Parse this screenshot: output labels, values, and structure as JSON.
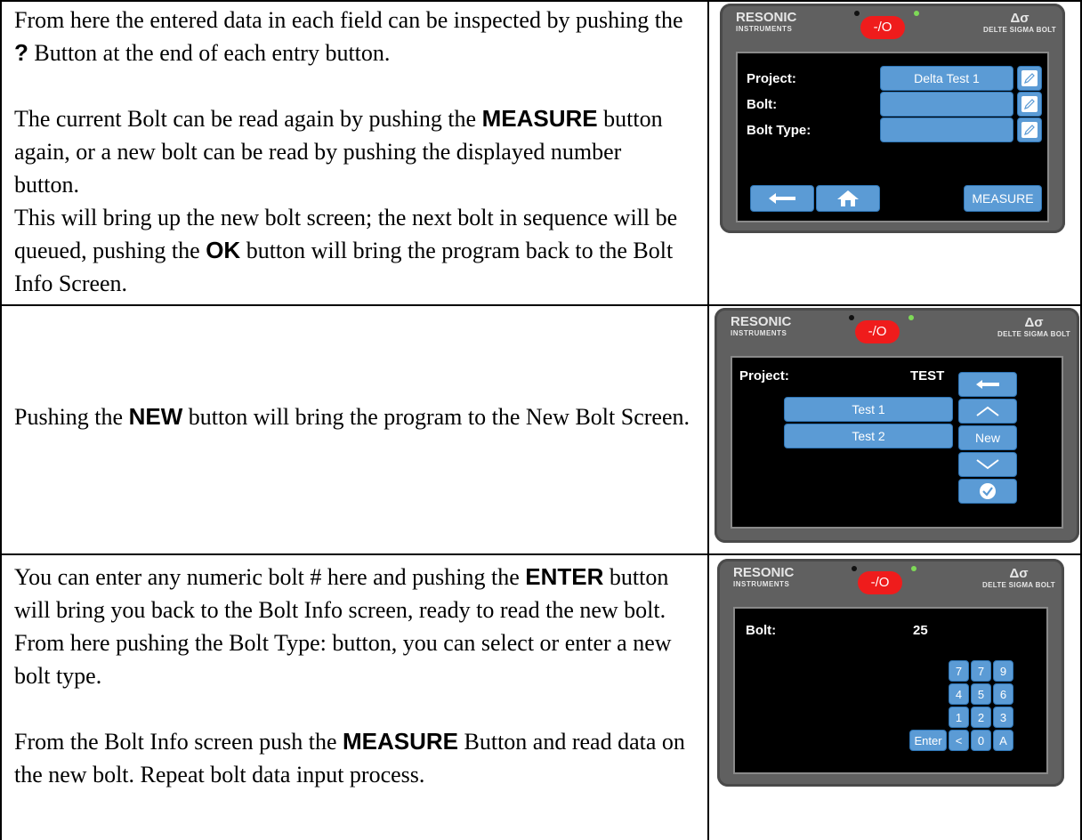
{
  "rows": [
    {
      "paragraphs": [
        [
          "From here the entered data in each field can be inspected by pushing the ",
          {
            "kw": "?"
          },
          " Button at the end of each entry button."
        ],
        [],
        [
          "The current Bolt can be read again by pushing the ",
          {
            "kw": "MEASURE"
          },
          " button again, or a new bolt can be read by pushing the displayed number button."
        ],
        [
          "This will bring up the new bolt screen; the next bolt in sequence will be queued, pushing the ",
          {
            "kw": "OK"
          },
          " button will bring the program back to the Bolt Info Screen."
        ]
      ]
    },
    {
      "paragraphs": [
        [
          "Pushing the ",
          {
            "kw": "NEW"
          },
          " button will bring the program to the New Bolt Screen."
        ]
      ]
    },
    {
      "paragraphs": [
        [
          "You can enter any numeric bolt # here and pushing the ",
          {
            "kw": "ENTER"
          },
          " button will bring you back to the Bolt Info screen, ready to read the new bolt. From here pushing the Bolt Type: button, you can select or enter a new bolt type."
        ],
        [],
        [
          "From the Bolt Info screen push the ",
          {
            "kw": "MEASURE"
          },
          " Button and read data on the new bolt. Repeat bolt data input process."
        ]
      ]
    }
  ],
  "device": {
    "brand": "RESONIC",
    "brand_sub": "INSTRUMENTS",
    "logo_symbol": "Δσ",
    "logo_sub": "DELTE SIGMA BOLT",
    "power_label": "-/O"
  },
  "screen1": {
    "project_label": "Project:",
    "bolt_label": "Bolt:",
    "bolt_type_label": "Bolt Type:",
    "project_value": "Delta Test 1",
    "bolt_value": "",
    "bolt_type_value": "",
    "measure_label": "MEASURE"
  },
  "screen2": {
    "project_label": "Project:",
    "project_value": "TEST",
    "items": [
      "Test 1",
      "Test 2"
    ],
    "new_label": "New"
  },
  "screen3": {
    "bolt_label": "Bolt:",
    "bolt_value": "25",
    "keys": [
      [
        "7",
        "7",
        "9"
      ],
      [
        "4",
        "5",
        "6"
      ],
      [
        "1",
        "2",
        "3"
      ]
    ],
    "enter_label": "Enter",
    "back_key": "<",
    "zero_key": "0",
    "a_key": "A"
  },
  "colors": {
    "button": "#5b9bd5",
    "power": "#ef1c1c",
    "bezel": "#606060"
  }
}
